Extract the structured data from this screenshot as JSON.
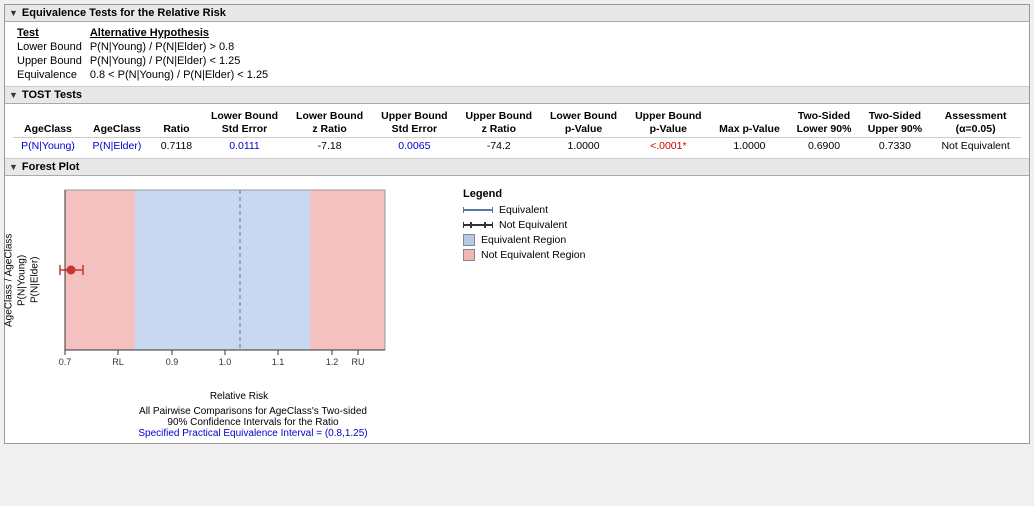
{
  "title": "Equivalence Tests for the Relative Risk",
  "equivTests": {
    "header": [
      "Test",
      "Alternative Hypothesis"
    ],
    "rows": [
      [
        "Lower Bound",
        "P(N|Young) / P(N|Elder) > 0.8"
      ],
      [
        "Upper Bound",
        "P(N|Young) / P(N|Elder) < 1.25"
      ],
      [
        "Equivalence",
        "0.8 < P(N|Young) / P(N|Elder) < 1.25"
      ]
    ]
  },
  "tostSection": {
    "title": "TOST Tests",
    "columns": [
      "AgeClass",
      "AgeClass",
      "Ratio",
      "Lower Bound Std Error",
      "Lower Bound z Ratio",
      "Upper Bound Std Error",
      "Upper Bound z Ratio",
      "Lower Bound p-Value",
      "Upper Bound p-Value",
      "Max p-Value",
      "Two-Sided Lower 90%",
      "Two-Sided Upper 90%",
      "Assessment (α=0.05)"
    ],
    "subheaders": [
      "P(N|Young)",
      "P(N|Elder)",
      "",
      "",
      "",
      "",
      "",
      "",
      "",
      "",
      "",
      "",
      ""
    ],
    "data": [
      [
        "P(N|Young)",
        "P(N|Elder)",
        "0.7118",
        "0.0111",
        "-7.18",
        "0.0065",
        "-74.2",
        "1.0000",
        "<.0001*",
        "1.0000",
        "0.6900",
        "0.7330",
        "Not Equivalent"
      ]
    ]
  },
  "forestPlot": {
    "title": "Forest Plot",
    "yAxisLabel": "AgeClass / AgeClass\nP(N|Young)\nP(N|Elder)",
    "xAxisLabel": "Relative Risk",
    "xTicks": [
      "0.7",
      "RL",
      "0.9",
      "1.0",
      "1.1",
      "1.2",
      "RU"
    ],
    "caption1": "All Pairwise Comparisons for AgeClass's Two-sided",
    "caption2": "90% Confidence Intervals for the Ratio",
    "caption3": "Specified Practical Equivalence Interval = (0.8,1.25)",
    "legend": {
      "title": "Legend",
      "items": [
        {
          "type": "equiv-line",
          "label": "Equivalent"
        },
        {
          "type": "notequiv-line",
          "label": "Not Equivalent"
        },
        {
          "type": "blue-box",
          "label": "Equivalent Region"
        },
        {
          "type": "pink-box",
          "label": "Not Equivalent Region"
        }
      ]
    }
  }
}
